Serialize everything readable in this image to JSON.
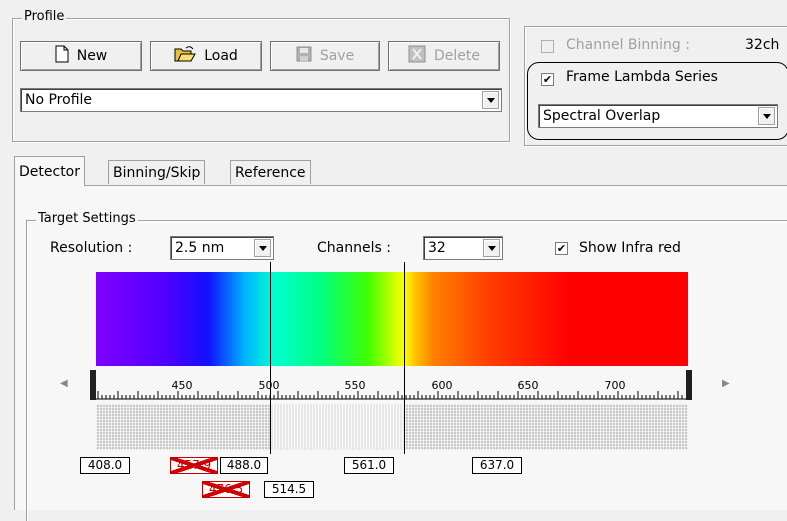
{
  "profile": {
    "legend": "Profile",
    "new_label": "New",
    "load_label": "Load",
    "save_label": "Save",
    "delete_label": "Delete",
    "selected": "No Profile"
  },
  "right_panel": {
    "channel_binning_label": "Channel Binning :",
    "channel_binning_value": "32ch",
    "channel_binning_checked": false,
    "frame_lambda_label": "Frame Lambda Series",
    "frame_lambda_checked": true,
    "mode_selected": "Spectral Overlap"
  },
  "tabs": [
    {
      "label": "Detector",
      "active": true
    },
    {
      "label": "Binning/Skip",
      "active": false
    },
    {
      "label": "Reference",
      "active": false
    }
  ],
  "target": {
    "legend": "Target Settings",
    "resolution_label": "Resolution :",
    "resolution_value": "2.5 nm",
    "channels_label": "Channels :",
    "channels_value": "32",
    "show_infrared_label": "Show Infra red",
    "show_infrared_checked": true
  },
  "spectrum": {
    "range_nm": [
      405,
      730
    ],
    "ruler_labels": [
      "450",
      "500",
      "550",
      "600",
      "650",
      "700"
    ],
    "cursors_nm": [
      500,
      560
    ],
    "laser_lines": [
      {
        "label": "408.0",
        "struck": false
      },
      {
        "label": "457.9",
        "struck": true
      },
      {
        "label": "488.0",
        "struck": false
      },
      {
        "label": "476.5",
        "struck": true
      },
      {
        "label": "514.5",
        "struck": false
      },
      {
        "label": "561.0",
        "struck": false
      },
      {
        "label": "637.0",
        "struck": false
      }
    ]
  },
  "colors": {
    "accent_struck": "#d00000",
    "panel_bg": "#f0f0f0"
  }
}
